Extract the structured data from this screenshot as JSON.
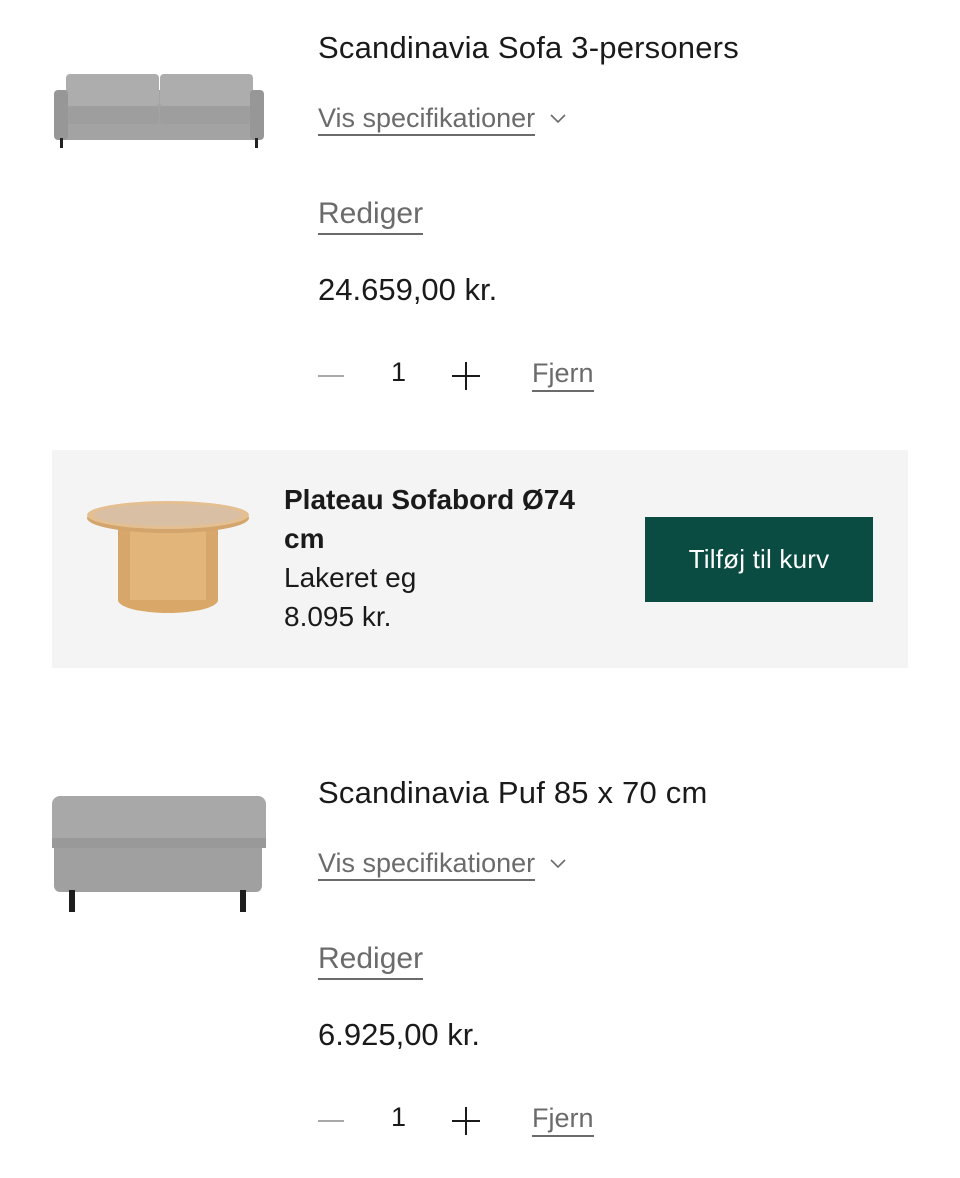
{
  "cart": {
    "items": [
      {
        "title": "Scandinavia Sofa 3-personers",
        "spec_label": "Vis specifikationer",
        "edit_label": "Rediger",
        "price": "24.659,00 kr.",
        "quantity": "1",
        "remove_label": "Fjern",
        "image": "sofa-image",
        "fabric_color": "#9a9a9a"
      },
      {
        "title": "Scandinavia Puf 85 x 70 cm",
        "spec_label": "Vis specifikationer",
        "edit_label": "Rediger",
        "price": "6.925,00 kr.",
        "quantity": "1",
        "remove_label": "Fjern",
        "image": "ottoman-image",
        "fabric_color": "#9a9a9a"
      }
    ]
  },
  "upsell": {
    "name": "Plateau Sofabord Ø74 cm",
    "variant": "Lakeret eg",
    "price": "8.095 kr.",
    "button_label": "Tilføj til kurv",
    "image": "coffee-table-image",
    "button_color": "#0b4c42",
    "background_color": "#f4f4f4"
  },
  "icons": {
    "chevron": "chevron-down-icon",
    "minus": "minus-icon",
    "plus": "plus-icon"
  }
}
